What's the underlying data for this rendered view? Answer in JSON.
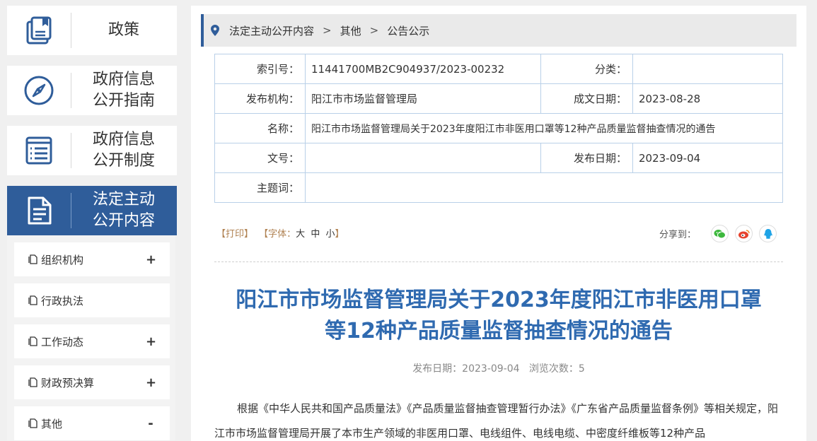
{
  "sidebar": {
    "cards": [
      {
        "label": "政策",
        "icon": "policy-book-icon"
      },
      {
        "label": "政府信息\n公开指南",
        "line1": "政府信息",
        "line2": "公开指南",
        "icon": "compass-icon"
      },
      {
        "label": "政府信息\n公开制度",
        "line1": "政府信息",
        "line2": "公开制度",
        "icon": "list-document-icon"
      },
      {
        "label": "法定主动\n公开内容",
        "line1": "法定主动",
        "line2": "公开内容",
        "icon": "document-icon"
      }
    ],
    "subitems": [
      {
        "label": "组织机构",
        "sign": "+"
      },
      {
        "label": "行政执法",
        "sign": ""
      },
      {
        "label": "工作动态",
        "sign": "+"
      },
      {
        "label": "财政预决算",
        "sign": "+"
      },
      {
        "label": "其他",
        "sign": "-"
      }
    ]
  },
  "breadcrumb": {
    "items": [
      "法定主动公开内容",
      "其他",
      "公告公示"
    ],
    "separator": ">"
  },
  "meta": {
    "index_label": "索引号：",
    "index_value": "11441700MB2C904937/2023-00232",
    "category_label": "分类：",
    "category_value": "",
    "publisher_label": "发布机构：",
    "publisher_value": "阳江市市场监督管理局",
    "written_date_label": "成文日期：",
    "written_date_value": "2023-08-28",
    "name_label": "名称：",
    "name_value": "阳江市市场监督管理局关于2023年度阳江市非医用口罩等12种产品质量监督抽查情况的通告",
    "doc_no_label": "文号：",
    "doc_no_value": "",
    "publish_date_label": "发布日期：",
    "publish_date_value": "2023-09-04",
    "keywords_label": "主题词：",
    "keywords_value": ""
  },
  "tools": {
    "print": "【打印】",
    "font_prefix": "【字体：",
    "font_large": "大",
    "font_medium": "中",
    "font_small": "小",
    "font_suffix": "】",
    "share_label": "分享到："
  },
  "article": {
    "title_line1": "阳江市市场监督管理局关于2023年度阳江市非医用口罩",
    "title_line2": "等12种产品质量监督抽查情况的通告",
    "info": "发布日期：2023-09-04   浏览次数：5",
    "paragraph": "根据《中华人民共和国产品质量法》《产品质量监督抽查管理暂行办法》《广东省产品质量监督条例》等相关规定，阳江市市场监督管理局开展了本市生产领域的非医用口罩、电线组件、电线电缆、中密度纤维板等12种产品"
  },
  "colors": {
    "brand_blue": "#2f5d9a",
    "title_blue": "#2f6ab0",
    "table_border": "#b9d0e8",
    "wechat_green": "#3db83d",
    "weibo_red": "#e6432d",
    "qq_blue": "#1fa3e6"
  }
}
